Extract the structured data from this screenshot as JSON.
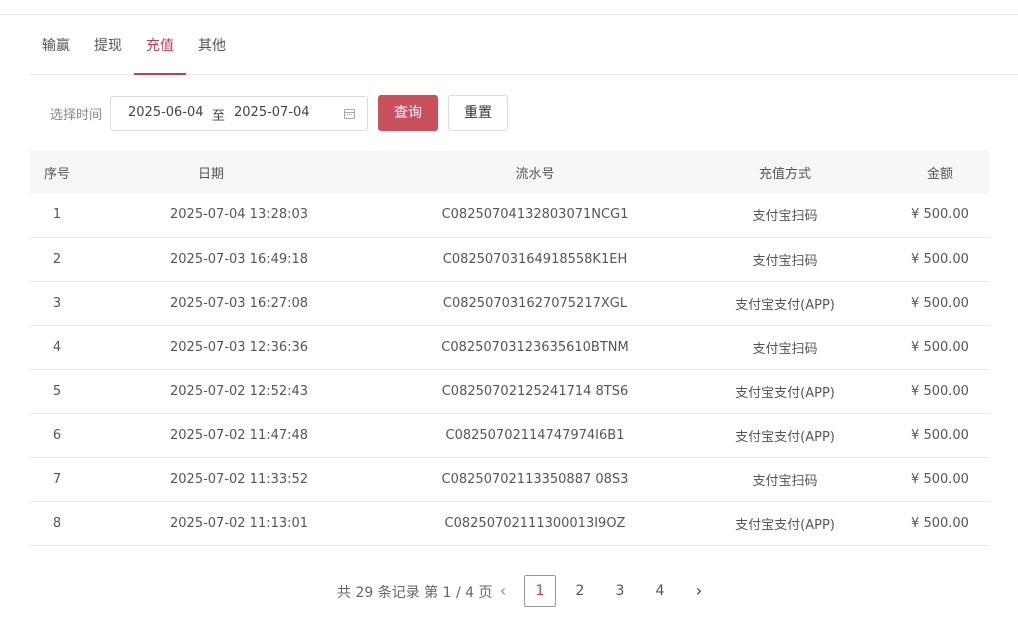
{
  "tabs": [
    {
      "label": "输赢"
    },
    {
      "label": "提现"
    },
    {
      "label": "充值"
    },
    {
      "label": "其他"
    }
  ],
  "filter": {
    "label": "选择时间",
    "start_date": "2025-06-04",
    "separator": "至",
    "end_date": "2025-07-04",
    "query_label": "查询",
    "reset_label": "重置"
  },
  "table": {
    "headers": [
      "序号",
      "日期",
      "流水号",
      "充值方式",
      "金额"
    ],
    "rows": [
      {
        "index": "1",
        "date": "2025-07-04 13:28:03",
        "serial": "C08250704132803071NCG1",
        "method": "支付宝扫码",
        "amount": "¥ 500.00"
      },
      {
        "index": "2",
        "date": "2025-07-03 16:49:18",
        "serial": "C08250703164918558K1EH",
        "method": "支付宝扫码",
        "amount": "¥ 500.00"
      },
      {
        "index": "3",
        "date": "2025-07-03 16:27:08",
        "serial": "C082507031627075217XGL",
        "method": "支付宝支付(APP)",
        "amount": "¥ 500.00"
      },
      {
        "index": "4",
        "date": "2025-07-03 12:36:36",
        "serial": "C08250703123635610BTNM",
        "method": "支付宝扫码",
        "amount": "¥ 500.00"
      },
      {
        "index": "5",
        "date": "2025-07-02 12:52:43",
        "serial": "C08250702125241714 8TS6",
        "method": "支付宝支付(APP)",
        "amount": "¥ 500.00"
      },
      {
        "index": "6",
        "date": "2025-07-02 11:47:48",
        "serial": "C08250702114747974I6B1",
        "method": "支付宝支付(APP)",
        "amount": "¥ 500.00"
      },
      {
        "index": "7",
        "date": "2025-07-02 11:33:52",
        "serial": "C08250702113350887 08S3",
        "method": "支付宝扫码",
        "amount": "¥ 500.00"
      },
      {
        "index": "8",
        "date": "2025-07-02 11:13:01",
        "serial": "C08250702111300013I9OZ",
        "method": "支付宝支付(APP)",
        "amount": "¥ 500.00"
      }
    ]
  },
  "pagination": {
    "summary": "共 29 条记录 第 1 / 4 页",
    "prev_icon": "chevron-left-icon",
    "next_icon": "chevron-right-icon",
    "pages": [
      "1",
      "2",
      "3",
      "4"
    ],
    "current": "1"
  },
  "colors": {
    "accent": "#b8424f",
    "query_button": "#c9515e",
    "table_header_bg": "#f5f7f9"
  }
}
